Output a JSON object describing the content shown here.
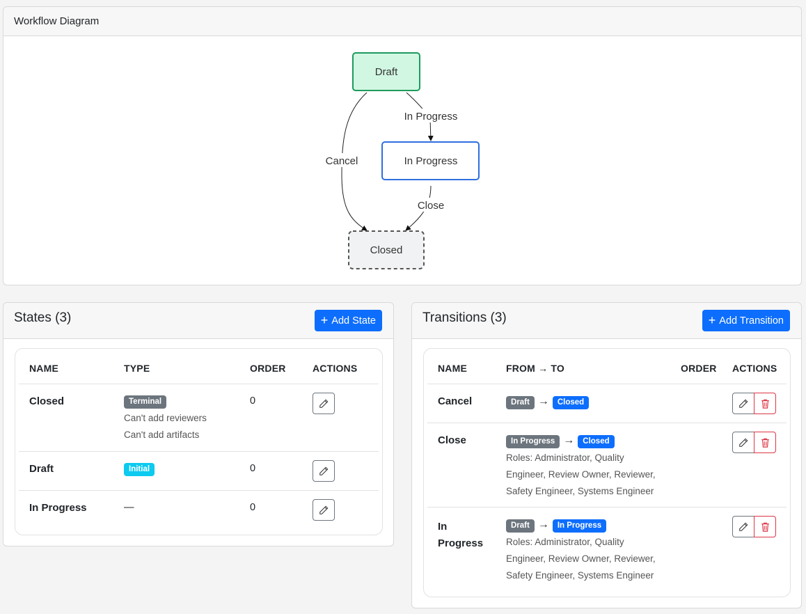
{
  "diagram": {
    "title": "Workflow Diagram",
    "nodes": {
      "draft": "Draft",
      "in_progress": "In Progress",
      "closed": "Closed"
    },
    "edges": {
      "draft_to_in_progress": "In Progress",
      "cancel": "Cancel",
      "close": "Close"
    },
    "colors": {
      "initial_fill": "#d1f7e2",
      "initial_border": "#1d9b5e",
      "normal_border": "#2f6fdf",
      "terminal_fill": "#f1f2f4",
      "terminal_border": "#555555"
    }
  },
  "states": {
    "title": "States (3)",
    "add_label": "Add State",
    "columns": [
      "NAME",
      "TYPE",
      "ORDER",
      "ACTIONS"
    ],
    "rows": [
      {
        "name": "Closed",
        "type": "Terminal",
        "notes": [
          "Can't add reviewers",
          "Can't add artifacts"
        ],
        "order": "0"
      },
      {
        "name": "Draft",
        "type": "Initial",
        "notes": [],
        "order": "0"
      },
      {
        "name": "In Progress",
        "type": "—",
        "notes": [],
        "order": "0"
      }
    ]
  },
  "transitions": {
    "title": "Transitions (3)",
    "add_label": "Add Transition",
    "columns": [
      "NAME",
      "FROM → TO",
      "ORDER",
      "ACTIONS"
    ],
    "rows": [
      {
        "name": "Cancel",
        "from": "Draft",
        "to": "Closed",
        "roles": []
      },
      {
        "name": "Close",
        "from": "In Progress",
        "to": "Closed",
        "roles": [
          "Roles: Administrator, Quality",
          "Engineer, Review Owner, Reviewer,",
          "Safety Engineer, Systems Engineer"
        ]
      },
      {
        "name_lines": [
          "In",
          "Progress"
        ],
        "from": "Draft",
        "to": "In Progress",
        "roles": [
          "Roles: Administrator, Quality",
          "Engineer, Review Owner, Reviewer,",
          "Safety Engineer, Systems Engineer"
        ]
      }
    ]
  },
  "icons": {
    "add": "plus-icon",
    "edit": "pencil-icon",
    "delete": "trash-icon",
    "arrow": "→"
  }
}
